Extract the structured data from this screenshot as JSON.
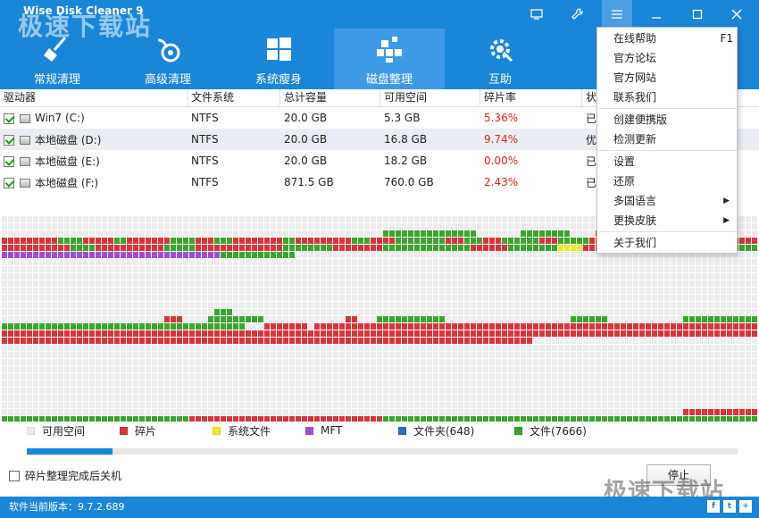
{
  "app": {
    "title": "Wise Disk Cleaner 9",
    "watermark": "极速下载站"
  },
  "toolbar": {
    "tabs": [
      {
        "label": "常规清理",
        "icon": "broom-icon"
      },
      {
        "label": "高级清理",
        "icon": "vacuum-icon"
      },
      {
        "label": "系统瘦身",
        "icon": "windows-icon"
      },
      {
        "label": "磁盘整理",
        "icon": "defrag-icon",
        "active": true
      },
      {
        "label": "互助",
        "icon": "gear-wrench-icon"
      }
    ],
    "window_buttons": [
      "screen-icon",
      "wrench-icon",
      "menu-icon",
      "minimize-icon",
      "maximize-icon",
      "close-icon"
    ]
  },
  "table": {
    "columns": [
      "驱动器",
      "文件系统",
      "总计容量",
      "可用空间",
      "碎片率",
      "状"
    ],
    "rows": [
      {
        "drive": "Win7 (C:)",
        "fs": "NTFS",
        "total": "20.0 GB",
        "free": "5.3 GB",
        "frag": "5.36%",
        "status": "已"
      },
      {
        "drive": "本地磁盘 (D:)",
        "fs": "NTFS",
        "total": "20.0 GB",
        "free": "16.8 GB",
        "frag": "9.74%",
        "status": "优"
      },
      {
        "drive": "本地磁盘 (E:)",
        "fs": "NTFS",
        "total": "20.0 GB",
        "free": "18.2 GB",
        "frag": "0.00%",
        "status": "已"
      },
      {
        "drive": "本地磁盘 (F:)",
        "fs": "NTFS",
        "total": "871.5 GB",
        "free": "760.0 GB",
        "frag": "2.43%",
        "status": "已"
      }
    ]
  },
  "legend": [
    {
      "label": "可用空间",
      "color": "#ececec"
    },
    {
      "label": "碎片",
      "color": "#d9343a"
    },
    {
      "label": "系统文件",
      "color": "#f2e52a"
    },
    {
      "label": "MFT",
      "color": "#9b4fd1"
    },
    {
      "label": "文件夹(648)",
      "color": "#2e6db8"
    },
    {
      "label": "文件(7666)",
      "color": "#3aa52c"
    }
  ],
  "progress": 0.12,
  "shutdown_option": "碎片整理完成后关机",
  "stop_button": "停止",
  "status": {
    "version": "软件当前版本：9.7.2.689"
  },
  "menu": {
    "items": [
      {
        "label": "在线帮助",
        "shortcut": "F1"
      },
      {
        "label": "官方论坛"
      },
      {
        "label": "官方网站"
      },
      {
        "label": "联系我们"
      },
      {
        "sep": true
      },
      {
        "label": "创建便携版"
      },
      {
        "label": "检测更新"
      },
      {
        "sep": true
      },
      {
        "label": "设置"
      },
      {
        "label": "还原"
      },
      {
        "label": "多国语言",
        "submenu": true
      },
      {
        "label": "更换皮肤",
        "submenu": true
      },
      {
        "sep": true
      },
      {
        "label": "关于我们"
      }
    ]
  }
}
